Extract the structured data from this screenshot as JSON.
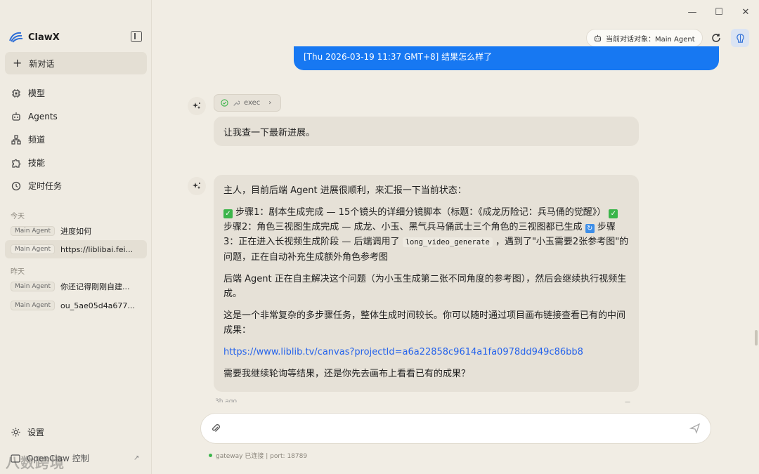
{
  "window": {
    "minimize": "—",
    "maximize": "☐",
    "close": "✕"
  },
  "sidebar": {
    "brand": "ClawX",
    "new_chat": "新对话",
    "nav": [
      {
        "label": "模型",
        "icon": "chip-icon"
      },
      {
        "label": "Agents",
        "icon": "robot-icon"
      },
      {
        "label": "频道",
        "icon": "network-icon"
      },
      {
        "label": "技能",
        "icon": "puzzle-icon"
      },
      {
        "label": "定时任务",
        "icon": "clock-icon"
      }
    ],
    "today_label": "今天",
    "yesterday_label": "昨天",
    "history": [
      {
        "tag": "Main Agent",
        "title": "进度如何"
      },
      {
        "tag": "Main Agent",
        "title": "https://liblibai.fei..."
      },
      {
        "tag": "Main Agent",
        "title": "你还记得刚刚自建..."
      },
      {
        "tag": "Main Agent",
        "title": "ou_5ae05d4a677..."
      }
    ],
    "settings": "设置",
    "footer_link": "OpenClaw 控制",
    "watermark": "八数跨境"
  },
  "topbar": {
    "agent_pill": "当前对话对象：Main Agent"
  },
  "chat": {
    "user_message": "[Thu 2026-03-19 11:37 GMT+8] 结果怎么样了",
    "tool_name": "exec",
    "msg1": "让我查一下最新进展。",
    "msg2": {
      "intro": "主人，目前后端 Agent 进展很顺利，来汇报一下当前状态：",
      "step1": "步骤1：剧本生成完成 — 15个镜头的详细分镜脚本（标题：《成龙历险记：兵马俑的觉醒》）",
      "step2": "步骤2：角色三视图生成完成 — 成龙、小玉、黑气兵马俑武士三个角色的三视图都已生成",
      "step3_a": "步骤3：正在进入长视频生成阶段 — 后端调用了",
      "step3_code": "long_video_generate",
      "step3_b": "，遇到了\"小玉需要2张参考图\"的问题，正在自动补充生成额外角色参考图",
      "para2": "后端 Agent 正在自主解决这个问题（为小玉生成第二张不同角度的参考图），然后会继续执行视频生成。",
      "para3": "这是一个非常复杂的多步骤任务，整体生成时间较长。你可以随时通过项目画布链接查看已有的中间成果：",
      "link": "https://www.liblib.tv/canvas?projectId=a6a22858c9614a1fa0978dd949c86bb8",
      "para4": "需要我继续轮询等结果，还是你先去画布上看看已有的成果？"
    },
    "timestamp": "3h ago"
  },
  "composer": {
    "placeholder": "",
    "status": "gateway 已连接 | port: 18789"
  }
}
